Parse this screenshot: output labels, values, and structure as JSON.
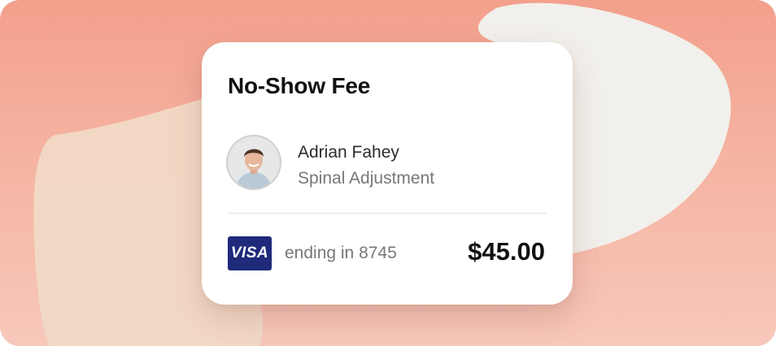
{
  "card": {
    "title": "No-Show Fee",
    "patient": {
      "name": "Adrian Fahey",
      "service": "Spinal Adjustment",
      "avatar_icon": "user-photo"
    },
    "payment": {
      "card_brand": "VISA",
      "ending_text": "ending in 8745",
      "amount": "$45.00"
    }
  },
  "colors": {
    "background_top": "#f3a08c",
    "background_bottom": "#f7c8bb",
    "visa_blue": "#1e2a7a",
    "title_text": "#111111",
    "secondary_text": "#777777"
  }
}
